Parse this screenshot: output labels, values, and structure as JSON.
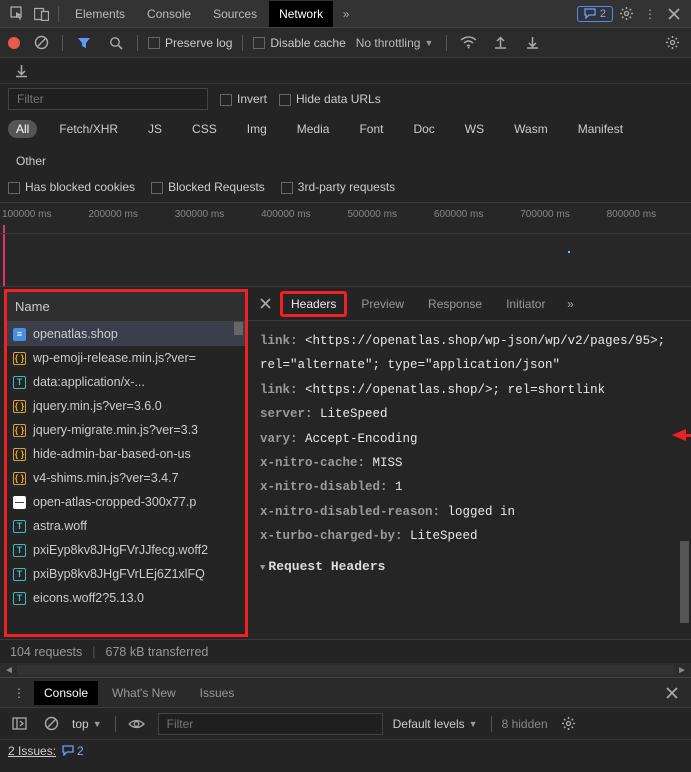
{
  "top_tabs": [
    "Elements",
    "Console",
    "Sources",
    "Network"
  ],
  "top_active": "Network",
  "messages_count": "2",
  "toolbar2": {
    "preserve": "Preserve log",
    "disable_cache": "Disable cache",
    "throttling": "No throttling"
  },
  "filter": {
    "placeholder": "Filter",
    "invert": "Invert",
    "hide_urls": "Hide data URLs"
  },
  "types": [
    "All",
    "Fetch/XHR",
    "JS",
    "CSS",
    "Img",
    "Media",
    "Font",
    "Doc",
    "WS",
    "Wasm",
    "Manifest",
    "Other"
  ],
  "type_active": "All",
  "checks": {
    "blocked_cookies": "Has blocked cookies",
    "blocked_req": "Blocked Requests",
    "third_party": "3rd-party requests"
  },
  "timeline_ticks": [
    "100000 ms",
    "200000 ms",
    "300000 ms",
    "400000 ms",
    "500000 ms",
    "600000 ms",
    "700000 ms",
    "800000 ms"
  ],
  "name_header": "Name",
  "requests": [
    {
      "icon": "doc",
      "name": "openatlas.shop",
      "selected": true
    },
    {
      "icon": "js",
      "name": "wp-emoji-release.min.js?ver="
    },
    {
      "icon": "t",
      "name": "data:application/x-..."
    },
    {
      "icon": "js",
      "name": "jquery.min.js?ver=3.6.0"
    },
    {
      "icon": "js",
      "name": "jquery-migrate.min.js?ver=3.3"
    },
    {
      "icon": "js",
      "name": "hide-admin-bar-based-on-us"
    },
    {
      "icon": "js",
      "name": "v4-shims.min.js?ver=3.4.7"
    },
    {
      "icon": "dash",
      "name": "open-atlas-cropped-300x77.p"
    },
    {
      "icon": "t",
      "name": "astra.woff"
    },
    {
      "icon": "t",
      "name": "pxiEyp8kv8JHgFVrJJfecg.woff2"
    },
    {
      "icon": "t",
      "name": "pxiByp8kv8JHgFVrLEj6Z1xlFQ"
    },
    {
      "icon": "t",
      "name": "eicons.woff2?5.13.0"
    }
  ],
  "detail_tabs": {
    "headers": "Headers",
    "preview": "Preview",
    "response": "Response",
    "initiator": "Initiator"
  },
  "headers": {
    "link1_key": "link:",
    "link1_val": "<https://openatlas.shop/wp-json/wp/v2/pages/95>; rel=\"alternate\"; type=\"application/json\"",
    "link2_key": "link:",
    "link2_val": "<https://openatlas.shop/>; rel=shortlink",
    "server_key": "server:",
    "server_val": "LiteSpeed",
    "vary_key": "vary:",
    "vary_val": "Accept-Encoding",
    "xnc_key": "x-nitro-cache:",
    "xnc_val": "MISS",
    "xnd_key": "x-nitro-disabled:",
    "xnd_val": "1",
    "xndr_key": "x-nitro-disabled-reason:",
    "xndr_val": "logged in",
    "xtc_key": "x-turbo-charged-by:",
    "xtc_val": "LiteSpeed"
  },
  "request_headers_title": "Request Headers",
  "footer": {
    "requests": "104 requests",
    "transferred": "678 kB transferred"
  },
  "console_tabs": {
    "console": "Console",
    "whatsnew": "What's New",
    "issues": "Issues"
  },
  "console": {
    "top": "top",
    "filter_ph": "Filter",
    "levels": "Default levels",
    "hidden": "8 hidden"
  },
  "issues_bar": {
    "label": "2 Issues:",
    "count": "2"
  }
}
